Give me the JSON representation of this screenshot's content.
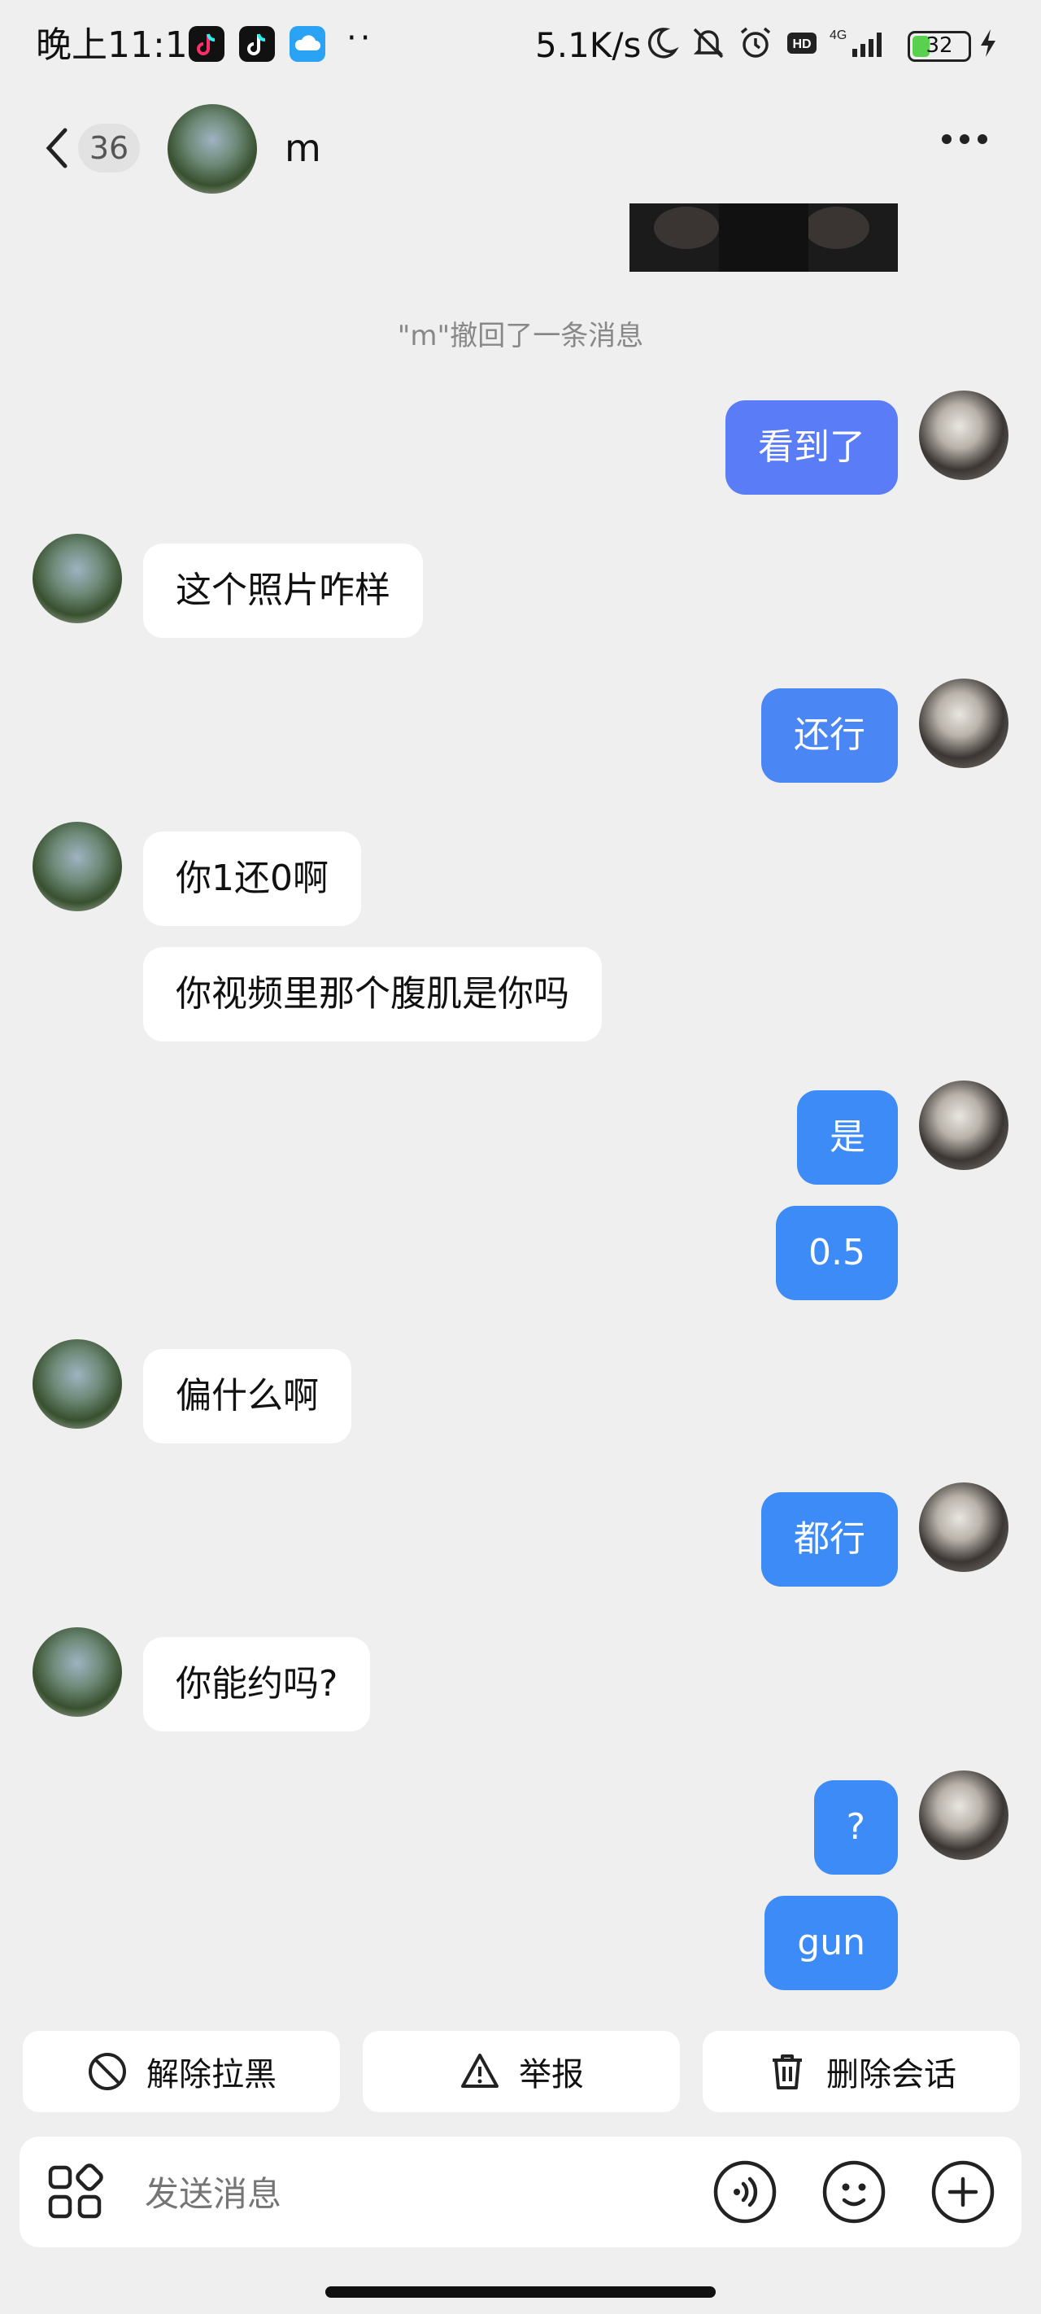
{
  "status_bar": {
    "time": "晚上11:12",
    "dots": "··",
    "net_speed": "5.1K/s",
    "battery": "32",
    "battery_fraction": 0.32,
    "icons": [
      "tiktok-lite-icon",
      "tiktok-icon",
      "cloud-icon",
      "moon-icon",
      "bell-off-icon",
      "alarm-icon",
      "hd-icon",
      "signal-4g-icon",
      "battery-icon",
      "charging-icon"
    ]
  },
  "header": {
    "unread_count": "36",
    "contact_name": "m"
  },
  "chat": {
    "recall_notice": "\"m\"撤回了一条消息",
    "messages": [
      {
        "side": "out",
        "text": "看到了"
      },
      {
        "side": "in",
        "text": "这个照片咋样"
      },
      {
        "side": "out",
        "text": "还行"
      },
      {
        "side": "in",
        "text": "你1还0啊"
      },
      {
        "side": "in",
        "text": "你视频里那个腹肌是你吗"
      },
      {
        "side": "out",
        "text": "是"
      },
      {
        "side": "out",
        "text": "0.5"
      },
      {
        "side": "in",
        "text": "偏什么啊"
      },
      {
        "side": "out",
        "text": "都行"
      },
      {
        "side": "in",
        "text": "你能约吗?"
      },
      {
        "side": "out",
        "text": "?"
      },
      {
        "side": "out",
        "text": "gun"
      }
    ]
  },
  "actions": {
    "unblock": "解除拉黑",
    "report": "举报",
    "delete": "删除会话"
  },
  "input": {
    "placeholder": "发送消息"
  },
  "colors": {
    "background": "#efefef",
    "outgoing_bubble": "#3d8bf6",
    "outgoing_bubble_alt": "#5b7cf7",
    "incoming_bubble": "#ffffff",
    "battery_fill": "#5ad04f"
  }
}
